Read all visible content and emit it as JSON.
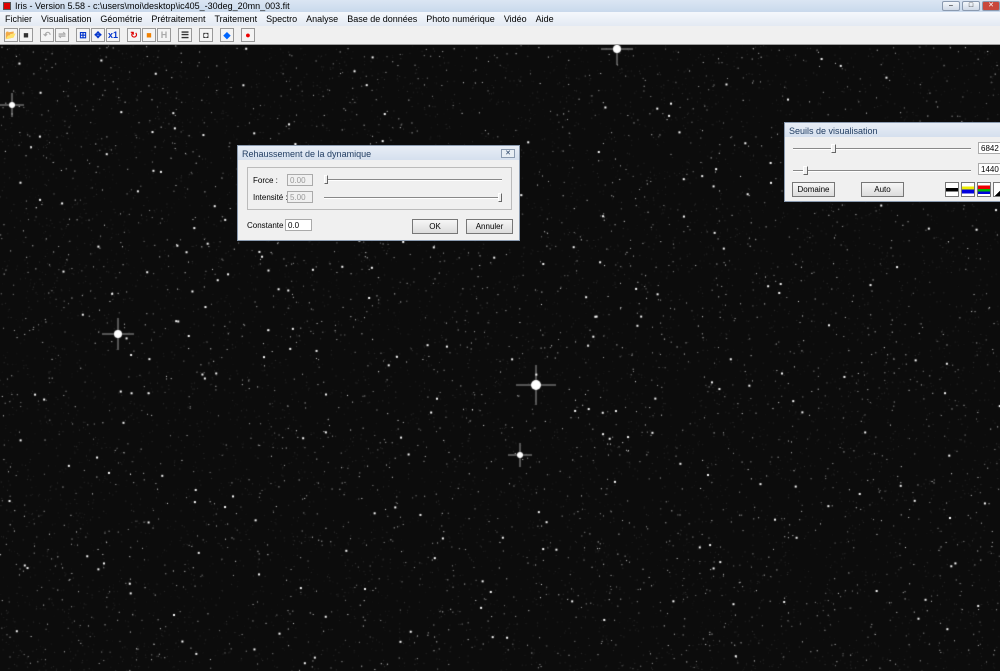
{
  "window": {
    "title": "Iris - Version 5.58 - c:\\users\\moi\\desktop\\ic405_-30deg_20mn_003.fit",
    "minimize": "–",
    "maximize": "□",
    "close": "✕"
  },
  "menu": [
    "Fichier",
    "Visualisation",
    "Géométrie",
    "Prétraitement",
    "Traitement",
    "Spectro",
    "Analyse",
    "Base de données",
    "Photo numérique",
    "Vidéo",
    "Aide"
  ],
  "toolbar": [
    {
      "icon": "open-folder-icon",
      "glyph": "📂",
      "color": "#b08000"
    },
    {
      "icon": "save-icon",
      "glyph": "■",
      "color": "#333"
    },
    {
      "icon": "undo-icon",
      "glyph": "↶",
      "color": "#aaa"
    },
    {
      "icon": "sliders-icon",
      "glyph": "⇌",
      "color": "#aaa"
    },
    {
      "icon": "grid-icon",
      "glyph": "⊞",
      "color": "#0033cc"
    },
    {
      "icon": "move-icon",
      "glyph": "✥",
      "color": "#0033cc"
    },
    {
      "icon": "zoom-x1-icon",
      "glyph": "x1",
      "color": "#0033cc"
    },
    {
      "icon": "refresh-icon",
      "glyph": "↻",
      "color": "#dd0000"
    },
    {
      "icon": "square-icon",
      "glyph": "■",
      "color": "#f08000"
    },
    {
      "icon": "histogram-icon",
      "glyph": "H",
      "color": "#aaa"
    },
    {
      "icon": "list-icon",
      "glyph": "☰",
      "color": "#333"
    },
    {
      "icon": "camera-icon",
      "glyph": "◘",
      "color": "#333"
    },
    {
      "icon": "diamond-icon",
      "glyph": "◆",
      "color": "#0066ff"
    },
    {
      "icon": "record-icon",
      "glyph": "●",
      "color": "#ee0000"
    }
  ],
  "dynamics_dialog": {
    "title": "Rehaussement de la dynamique",
    "close": "✕",
    "force_label": "Force :",
    "force_value": "0.00",
    "force_level": 0,
    "intensity_label": "Intensité :",
    "intensity_value": "5.00",
    "intensity_level": 1,
    "constant_label": "Constante :",
    "constant_value": "0.0",
    "ok": "OK",
    "cancel": "Annuler"
  },
  "thresholds": {
    "title": "Seuils de visualisation",
    "high_value": "6842",
    "low_value": "1440",
    "domain": "Domaine",
    "auto": "Auto"
  }
}
